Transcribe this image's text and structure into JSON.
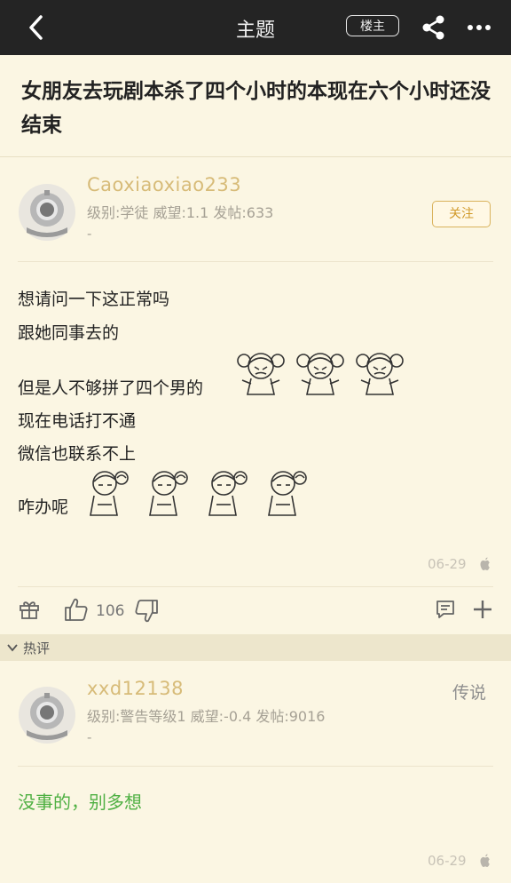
{
  "header": {
    "title": "主题",
    "op_button": "楼主"
  },
  "post": {
    "title": "女朋友去玩剧本杀了四个小时的本现在六个小时还没结束",
    "author": {
      "name": "Caoxiaoxiao233",
      "meta": "级别:学徒 威望:1.1 发帖:633",
      "extra": "-",
      "follow_label": "关注"
    },
    "lines": [
      "想请问一下这正常吗",
      "跟她同事去的",
      "但是人不够拼了四个男的",
      "现在电话打不通",
      "微信也联系不上",
      "咋办呢"
    ],
    "date": "06-29",
    "like_count": "106"
  },
  "hot": {
    "label": "热评"
  },
  "reply": {
    "author": {
      "name": "xxd12138",
      "meta": "级别:警告等级1 威望:-0.4 发帖:9016",
      "extra": "-"
    },
    "rank": "传说",
    "text": "没事的，别多想",
    "date": "06-29"
  },
  "colors": {
    "topbar": "#242424",
    "background": "#fbf6e3",
    "username": "#d7bb78",
    "reply_text": "#4fb043",
    "follow": "#d19a2a"
  },
  "icons": [
    "back-icon",
    "share-icon",
    "more-icon",
    "gift-icon",
    "thumbs-up-icon",
    "thumbs-down-icon",
    "comment-icon",
    "plus-icon",
    "apple-icon",
    "chevron-down-icon"
  ]
}
